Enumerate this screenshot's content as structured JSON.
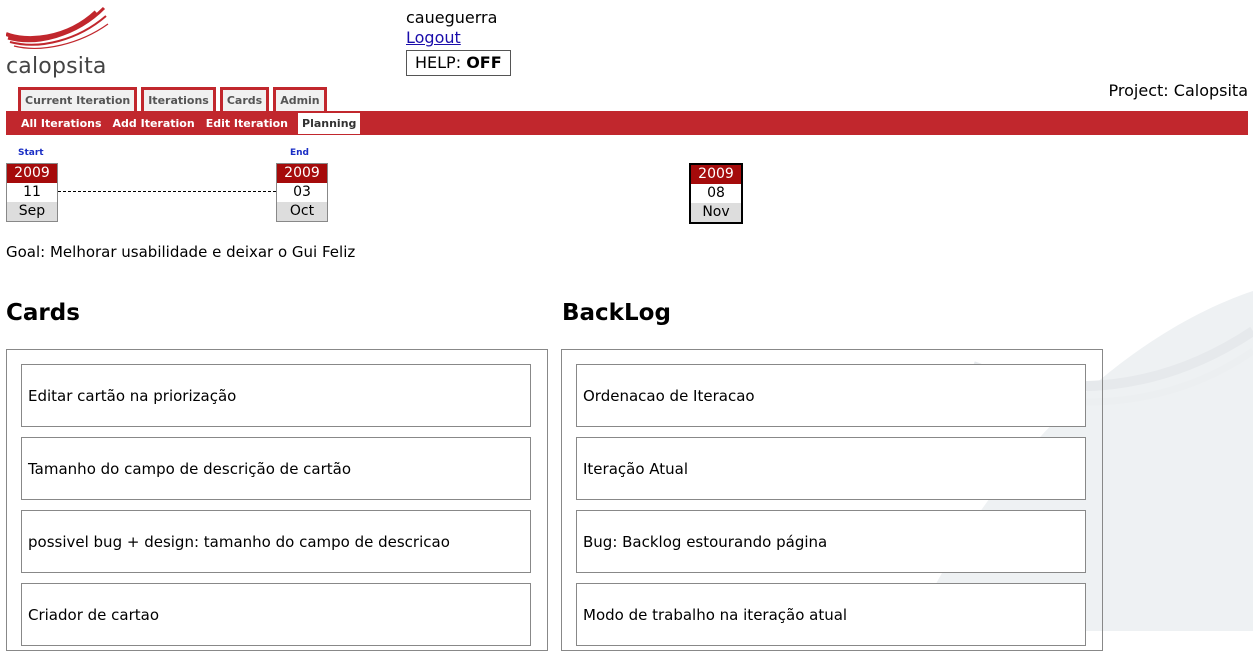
{
  "brand": {
    "name": "calopsita"
  },
  "user": {
    "username": "caueguerra",
    "logout_label": "Logout",
    "help_label": "HELP:",
    "help_state": "OFF"
  },
  "project": {
    "label": "Project: Calopsita"
  },
  "main_tabs": [
    {
      "label": "Current Iteration"
    },
    {
      "label": "Iterations"
    },
    {
      "label": "Cards"
    },
    {
      "label": "Admin"
    }
  ],
  "sub_tabs": [
    {
      "label": "All Iterations"
    },
    {
      "label": "Add Iteration"
    },
    {
      "label": "Edit Iteration"
    },
    {
      "label": "Planning",
      "active": true
    }
  ],
  "dates": {
    "start_label": "Start",
    "end_label": "End",
    "start": {
      "year": "2009",
      "day": "11",
      "month": "Sep"
    },
    "end": {
      "year": "2009",
      "day": "03",
      "month": "Oct"
    },
    "today": {
      "year": "2009",
      "day": "08",
      "month": "Nov"
    }
  },
  "goal": "Goal: Melhorar usabilidade e deixar o Gui Feliz",
  "cards_section": {
    "title": "Cards",
    "items": [
      "Editar cartão na priorização",
      "Tamanho do campo de descrição de cartão",
      "possivel bug + design: tamanho do campo de descricao",
      "Criador de cartao"
    ]
  },
  "backlog_section": {
    "title": "BackLog",
    "items": [
      "Ordenacao de Iteracao",
      "Iteração Atual",
      "Bug: Backlog estourando página",
      "Modo de trabalho na iteração atual"
    ]
  },
  "colors": {
    "brand_red": "#c1272d",
    "calendar_red": "#a50b0b",
    "link_blue": "#1a0dab"
  }
}
